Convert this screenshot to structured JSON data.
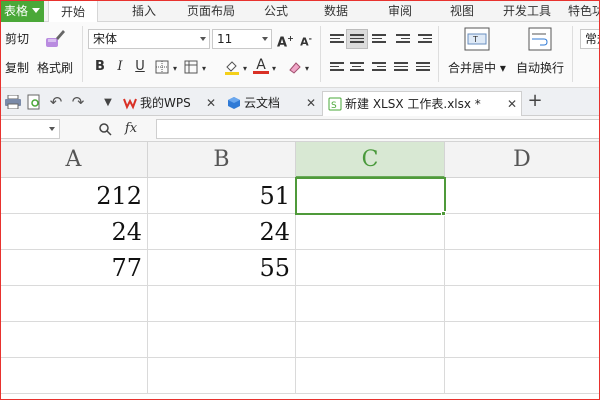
{
  "app": {
    "menu_label": "表格"
  },
  "ribbon_tabs": [
    {
      "label": "开始",
      "active": true
    },
    {
      "label": "插入"
    },
    {
      "label": "页面布局"
    },
    {
      "label": "公式"
    },
    {
      "label": "数据"
    },
    {
      "label": "审阅"
    },
    {
      "label": "视图"
    },
    {
      "label": "开发工具"
    },
    {
      "label": "特色功"
    }
  ],
  "ribbon": {
    "cut_label": "剪切",
    "copy_label": "复制",
    "format_painter_label": "格式刷",
    "font_name": "宋体",
    "font_size": "11",
    "bold": "B",
    "italic": "I",
    "underline": "U",
    "merge_center_label": "合并居中",
    "wrap_text_label": "自动换行",
    "number_format": "常规"
  },
  "doc_tabs": [
    {
      "label": "我的WPS",
      "icon": "wps-logo-icon",
      "closable": true
    },
    {
      "label": "云文档",
      "icon": "cloud-docs-icon",
      "closable": true
    },
    {
      "label": "新建 XLSX 工作表.xlsx *",
      "icon": "spreadsheet-file-icon",
      "closable": true,
      "active": true
    }
  ],
  "formula_bar": {
    "name_box": "",
    "fx_label": "fx",
    "formula": ""
  },
  "columns": [
    "A",
    "B",
    "C",
    "D"
  ],
  "selected_column": "C",
  "rows": [
    [
      "212",
      "51",
      "",
      ""
    ],
    [
      "24",
      "24",
      "",
      ""
    ],
    [
      "77",
      "55",
      "",
      ""
    ],
    [
      "",
      "",
      "",
      ""
    ],
    [
      "",
      "",
      "",
      ""
    ],
    [
      "",
      "",
      "",
      ""
    ]
  ],
  "colors": {
    "accent": "#4aa838",
    "selection": "#4f9a3a",
    "wps_red": "#d93025",
    "cloud_blue": "#2f7ad6"
  }
}
